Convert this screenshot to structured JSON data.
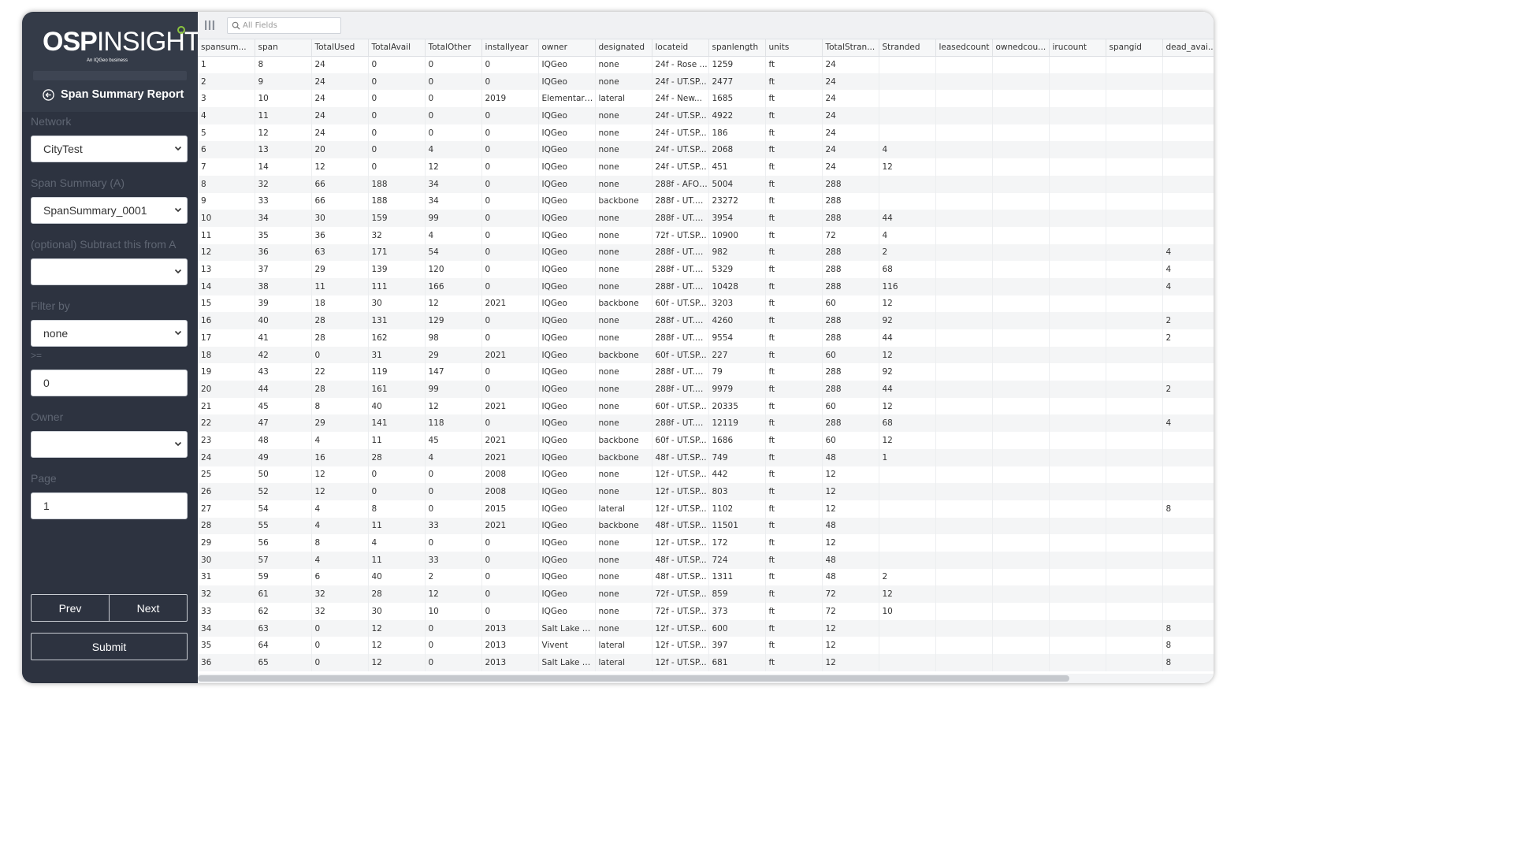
{
  "brand": {
    "logo_bold": "OSP",
    "logo_thin": "INSIGHT",
    "logo_sub": "An IQGeo business"
  },
  "report": {
    "title": "Span Summary Report"
  },
  "form": {
    "network_label": "Network",
    "network_value": "CityTest",
    "summary_label": "Span Summary (A)",
    "summary_value": "SpanSummary_0001",
    "subtract_label": "(optional) Subtract this from A",
    "subtract_value": "",
    "filter_label": "Filter by",
    "filter_value": "none",
    "gte_label": ">=",
    "gte_value": "0",
    "owner_label": "Owner",
    "owner_value": "",
    "page_label": "Page",
    "page_value": "1",
    "prev_label": "Prev",
    "next_label": "Next",
    "submit_label": "Submit"
  },
  "search": {
    "placeholder": "All Fields"
  },
  "columns": [
    "spansum...",
    "span",
    "TotalUsed",
    "TotalAvail",
    "TotalOther",
    "installyear",
    "owner",
    "designated",
    "locateid",
    "spanlength",
    "units",
    "TotalStran...",
    "Stranded",
    "leasedcount",
    "ownedcou...",
    "irucount",
    "spangid",
    "dead_avai..."
  ],
  "rows": [
    [
      "1",
      "8",
      "24",
      "0",
      "0",
      "0",
      "IQGeo",
      "none",
      "24f - Rose ...",
      "1259",
      "ft",
      "24",
      "",
      "",
      "",
      "",
      "",
      ""
    ],
    [
      "2",
      "9",
      "24",
      "0",
      "0",
      "0",
      "IQGeo",
      "none",
      "24f - UT.SP...",
      "2477",
      "ft",
      "24",
      "",
      "",
      "",
      "",
      "",
      ""
    ],
    [
      "3",
      "10",
      "24",
      "0",
      "0",
      "2019",
      "Elementary...",
      "lateral",
      "24f - New...",
      "1685",
      "ft",
      "24",
      "",
      "",
      "",
      "",
      "",
      ""
    ],
    [
      "4",
      "11",
      "24",
      "0",
      "0",
      "0",
      "IQGeo",
      "none",
      "24f - UT.SP...",
      "4922",
      "ft",
      "24",
      "",
      "",
      "",
      "",
      "",
      ""
    ],
    [
      "5",
      "12",
      "24",
      "0",
      "0",
      "0",
      "IQGeo",
      "none",
      "24f - UT.SP...",
      "186",
      "ft",
      "24",
      "",
      "",
      "",
      "",
      "",
      ""
    ],
    [
      "6",
      "13",
      "20",
      "0",
      "4",
      "0",
      "IQGeo",
      "none",
      "24f - UT.SP...",
      "2068",
      "ft",
      "24",
      "4",
      "",
      "",
      "",
      "",
      ""
    ],
    [
      "7",
      "14",
      "12",
      "0",
      "12",
      "0",
      "IQGeo",
      "none",
      "24f - UT.SP...",
      "451",
      "ft",
      "24",
      "12",
      "",
      "",
      "",
      "",
      ""
    ],
    [
      "8",
      "32",
      "66",
      "188",
      "34",
      "0",
      "IQGeo",
      "none",
      "288f - AFO ...",
      "5004",
      "ft",
      "288",
      "",
      "",
      "",
      "",
      "",
      ""
    ],
    [
      "9",
      "33",
      "66",
      "188",
      "34",
      "0",
      "IQGeo",
      "backbone",
      "288f - UT.S...",
      "23272",
      "ft",
      "288",
      "",
      "",
      "",
      "",
      "",
      ""
    ],
    [
      "10",
      "34",
      "30",
      "159",
      "99",
      "0",
      "IQGeo",
      "none",
      "288f - UT.S...",
      "3954",
      "ft",
      "288",
      "44",
      "",
      "",
      "",
      "",
      ""
    ],
    [
      "11",
      "35",
      "36",
      "32",
      "4",
      "0",
      "IQGeo",
      "none",
      "72f - UT.SP...",
      "10900",
      "ft",
      "72",
      "4",
      "",
      "",
      "",
      "",
      ""
    ],
    [
      "12",
      "36",
      "63",
      "171",
      "54",
      "0",
      "IQGeo",
      "none",
      "288f - UT.S...",
      "982",
      "ft",
      "288",
      "2",
      "",
      "",
      "",
      "",
      "4"
    ],
    [
      "13",
      "37",
      "29",
      "139",
      "120",
      "0",
      "IQGeo",
      "none",
      "288f - UT.S...",
      "5329",
      "ft",
      "288",
      "68",
      "",
      "",
      "",
      "",
      "4"
    ],
    [
      "14",
      "38",
      "11",
      "111",
      "166",
      "0",
      "IQGeo",
      "none",
      "288f - UT.S...",
      "10428",
      "ft",
      "288",
      "116",
      "",
      "",
      "",
      "",
      "4"
    ],
    [
      "15",
      "39",
      "18",
      "30",
      "12",
      "2021",
      "IQGeo",
      "backbone",
      "60f - UT.SP...",
      "3203",
      "ft",
      "60",
      "12",
      "",
      "",
      "",
      "",
      ""
    ],
    [
      "16",
      "40",
      "28",
      "131",
      "129",
      "0",
      "IQGeo",
      "none",
      "288f - UT.S...",
      "4260",
      "ft",
      "288",
      "92",
      "",
      "",
      "",
      "",
      "2"
    ],
    [
      "17",
      "41",
      "28",
      "162",
      "98",
      "0",
      "IQGeo",
      "none",
      "288f - UT.S...",
      "9554",
      "ft",
      "288",
      "44",
      "",
      "",
      "",
      "",
      "2"
    ],
    [
      "18",
      "42",
      "0",
      "31",
      "29",
      "2021",
      "IQGeo",
      "backbone",
      "60f - UT.SP...",
      "227",
      "ft",
      "60",
      "12",
      "",
      "",
      "",
      "",
      ""
    ],
    [
      "19",
      "43",
      "22",
      "119",
      "147",
      "0",
      "IQGeo",
      "none",
      "288f - UT.S...",
      "79",
      "ft",
      "288",
      "92",
      "",
      "",
      "",
      "",
      ""
    ],
    [
      "20",
      "44",
      "28",
      "161",
      "99",
      "0",
      "IQGeo",
      "none",
      "288f - UT.S...",
      "9979",
      "ft",
      "288",
      "44",
      "",
      "",
      "",
      "",
      "2"
    ],
    [
      "21",
      "45",
      "8",
      "40",
      "12",
      "2021",
      "IQGeo",
      "none",
      "60f - UT.SP...",
      "20335",
      "ft",
      "60",
      "12",
      "",
      "",
      "",
      "",
      ""
    ],
    [
      "22",
      "47",
      "29",
      "141",
      "118",
      "0",
      "IQGeo",
      "none",
      "288f - UT.S...",
      "12119",
      "ft",
      "288",
      "68",
      "",
      "",
      "",
      "",
      "4"
    ],
    [
      "23",
      "48",
      "4",
      "11",
      "45",
      "2021",
      "IQGeo",
      "backbone",
      "60f - UT.SP...",
      "1686",
      "ft",
      "60",
      "12",
      "",
      "",
      "",
      "",
      ""
    ],
    [
      "24",
      "49",
      "16",
      "28",
      "4",
      "2021",
      "IQGeo",
      "backbone",
      "48f - UT.SP...",
      "749",
      "ft",
      "48",
      "1",
      "",
      "",
      "",
      "",
      ""
    ],
    [
      "25",
      "50",
      "12",
      "0",
      "0",
      "2008",
      "IQGeo",
      "none",
      "12f - UT.SP...",
      "442",
      "ft",
      "12",
      "",
      "",
      "",
      "",
      "",
      ""
    ],
    [
      "26",
      "52",
      "12",
      "0",
      "0",
      "2008",
      "IQGeo",
      "none",
      "12f - UT.SP...",
      "803",
      "ft",
      "12",
      "",
      "",
      "",
      "",
      "",
      ""
    ],
    [
      "27",
      "54",
      "4",
      "8",
      "0",
      "2015",
      "IQGeo",
      "lateral",
      "12f - UT.SP...",
      "1102",
      "ft",
      "12",
      "",
      "",
      "",
      "",
      "",
      "8"
    ],
    [
      "28",
      "55",
      "4",
      "11",
      "33",
      "2021",
      "IQGeo",
      "backbone",
      "48f - UT.SP...",
      "11501",
      "ft",
      "48",
      "",
      "",
      "",
      "",
      "",
      ""
    ],
    [
      "29",
      "56",
      "8",
      "4",
      "0",
      "0",
      "IQGeo",
      "none",
      "12f - UT.SP...",
      "172",
      "ft",
      "12",
      "",
      "",
      "",
      "",
      "",
      ""
    ],
    [
      "30",
      "57",
      "4",
      "11",
      "33",
      "0",
      "IQGeo",
      "none",
      "48f - UT.SP...",
      "724",
      "ft",
      "48",
      "",
      "",
      "",
      "",
      "",
      ""
    ],
    [
      "31",
      "59",
      "6",
      "40",
      "2",
      "0",
      "IQGeo",
      "none",
      "48f - UT.SP...",
      "1311",
      "ft",
      "48",
      "2",
      "",
      "",
      "",
      "",
      ""
    ],
    [
      "32",
      "61",
      "32",
      "28",
      "12",
      "0",
      "IQGeo",
      "none",
      "72f - UT.SP...",
      "859",
      "ft",
      "72",
      "12",
      "",
      "",
      "",
      "",
      ""
    ],
    [
      "33",
      "62",
      "32",
      "30",
      "10",
      "0",
      "IQGeo",
      "none",
      "72f - UT.SP...",
      "373",
      "ft",
      "72",
      "10",
      "",
      "",
      "",
      "",
      ""
    ],
    [
      "34",
      "63",
      "0",
      "12",
      "0",
      "2013",
      "Salt Lake C...",
      "none",
      "12f - UT.SP...",
      "600",
      "ft",
      "12",
      "",
      "",
      "",
      "",
      "",
      "8"
    ],
    [
      "35",
      "64",
      "0",
      "12",
      "0",
      "2013",
      "Vivent",
      "lateral",
      "12f - UT.SP...",
      "397",
      "ft",
      "12",
      "",
      "",
      "",
      "",
      "",
      "8"
    ],
    [
      "36",
      "65",
      "0",
      "12",
      "0",
      "2013",
      "Salt Lake C...",
      "lateral",
      "12f - UT.SP...",
      "681",
      "ft",
      "12",
      "",
      "",
      "",
      "",
      "",
      "8"
    ]
  ],
  "theme": {
    "sidebar_bg": "#343b48",
    "sidebar_form_bg": "#2d3340",
    "accent_green": "#8cc63f",
    "row_stripe": "#f4f5f6"
  },
  "icons": {
    "logo_status": "green-circle-icon",
    "back": "back-arrow-circle-icon",
    "columns": "columns-icon",
    "search": "search-icon",
    "select": "chevron-down-icon"
  }
}
